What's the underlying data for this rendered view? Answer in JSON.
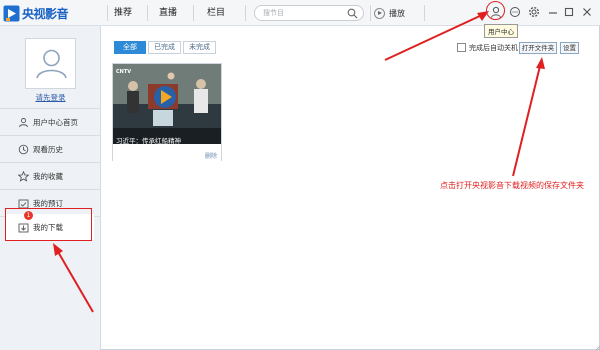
{
  "app": {
    "name": "央视影音"
  },
  "nav": {
    "tabs": [
      "推荐",
      "直播",
      "栏目"
    ]
  },
  "search": {
    "placeholder": "搜节目"
  },
  "toolbar": {
    "play_label": "播放",
    "tooltip": "用户中心"
  },
  "sidebar": {
    "login_label": "请先登录",
    "items": [
      {
        "label": "用户中心首页",
        "icon": "user-icon"
      },
      {
        "label": "观看历史",
        "icon": "history-icon"
      },
      {
        "label": "我的收藏",
        "icon": "star-icon"
      },
      {
        "label": "我的预订",
        "icon": "calendar-icon"
      },
      {
        "label": "我的下载",
        "icon": "download-icon",
        "badge": "1",
        "active": true
      }
    ]
  },
  "main": {
    "filters": [
      {
        "label": "全部",
        "active": true
      },
      {
        "label": "已完成",
        "active": false
      },
      {
        "label": "未完成",
        "active": false
      }
    ],
    "shutdown_label": "完成后自动关机",
    "open_folder_label": "打开文件夹",
    "settings_label": "设置",
    "video": {
      "title": "习近平：传承红船精神",
      "delete_label": "删除",
      "logo_text": "CNTV"
    }
  },
  "annotation": {
    "text": "点击打开央视影音下载视频的保存文件夹"
  },
  "colors": {
    "accent": "#2d8ad6",
    "annotation": "#e02020",
    "brand": "#1a62c4",
    "sidebar_bg": "#eef2f6"
  }
}
